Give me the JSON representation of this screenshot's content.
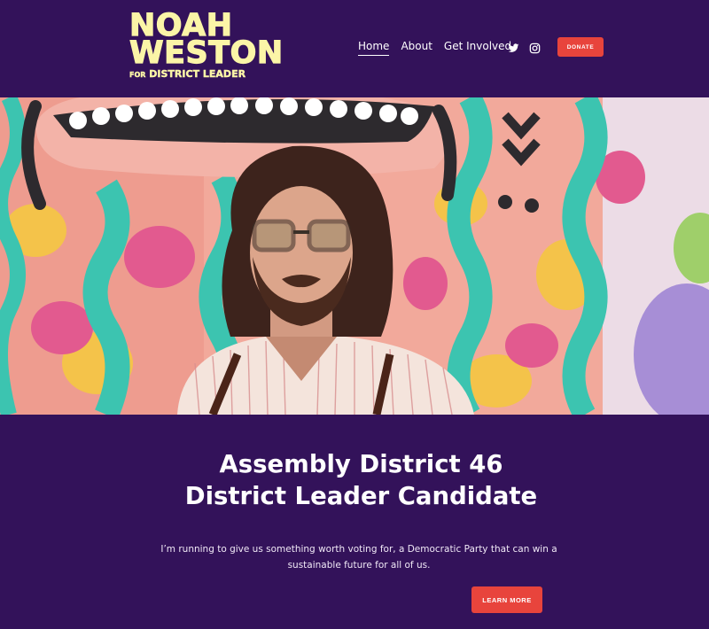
{
  "logo": {
    "line1": "NOAH",
    "line2": "WESTON",
    "for": "FOR",
    "line3": "DISTRICT LEADER"
  },
  "nav": {
    "items": [
      "Home",
      "About",
      "Get Involved"
    ],
    "active": "Home"
  },
  "social": {
    "icons": [
      "twitter-icon",
      "instagram-icon"
    ]
  },
  "header": {
    "donate_label": "DONATE"
  },
  "hero": {
    "image_alt": "Portrait of a bearded man with glasses in front of a colorful mural"
  },
  "main": {
    "headline_line1": "Assembly District 46",
    "headline_line2": "District Leader Candidate",
    "intro": "I’m running to give us something worth voting for, a Democratic Party that can win a sustainable future for all of us.",
    "cta_label": "LEARN MORE"
  },
  "colors": {
    "background": "#33125a",
    "logo": "#fbf5a7",
    "accent": "#e8443c"
  }
}
